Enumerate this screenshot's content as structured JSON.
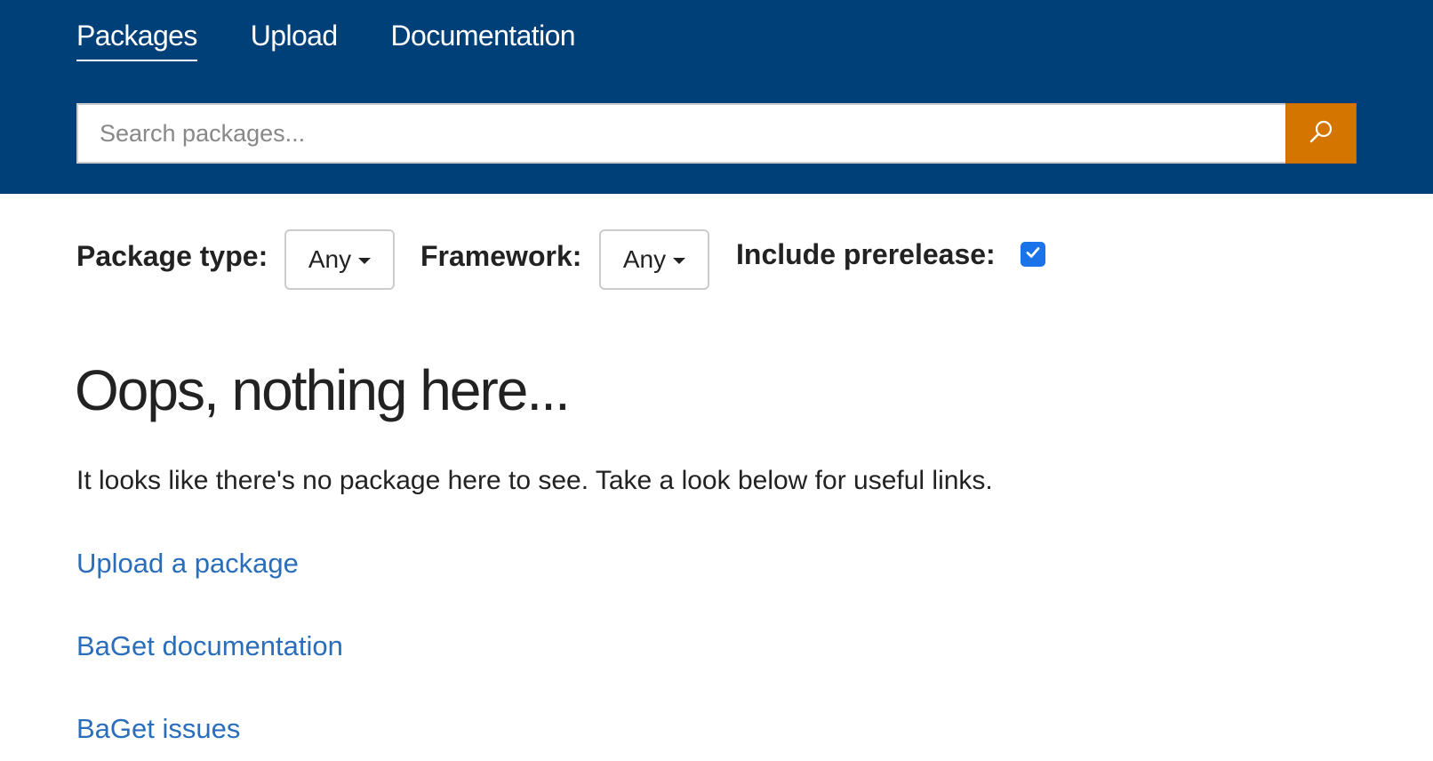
{
  "nav": {
    "items": [
      {
        "label": "Packages",
        "active": true
      },
      {
        "label": "Upload",
        "active": false
      },
      {
        "label": "Documentation",
        "active": false
      }
    ]
  },
  "search": {
    "placeholder": "Search packages...",
    "value": "",
    "button_icon": "search-icon"
  },
  "filters": {
    "package_type_label": "Package type:",
    "package_type_value": "Any",
    "framework_label": "Framework:",
    "framework_value": "Any",
    "prerelease_label": "Include prerelease:",
    "prerelease_checked": true
  },
  "empty_state": {
    "title": "Oops, nothing here...",
    "message": "It looks like there's no package here to see. Take a look below for useful links.",
    "links": [
      {
        "label": "Upload a package"
      },
      {
        "label": "BaGet documentation"
      },
      {
        "label": "BaGet issues"
      }
    ]
  },
  "colors": {
    "header_bg": "#004078",
    "search_button_bg": "#d47500",
    "link": "#2a6ebb",
    "checkbox": "#1a73e8"
  }
}
